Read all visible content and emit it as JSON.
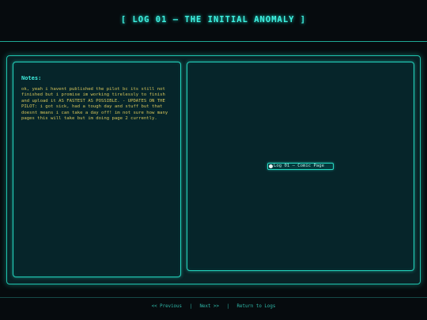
{
  "header": {
    "title": "[ LOG 01 — THE INITIAL ANOMALY ]"
  },
  "notes": {
    "heading": "Notes:",
    "body": "ok, yeah i havent published the pilot bc its still not finished but i promise im working tirelessly to finish and upload it AS FASTEST AS POSSIBLE. - UPDATES ON THE PILOT: i got sick, had a tough day and stuff but that doesnt means i can take a day off! im not sure how many pages this will take but im doing page 2 currently."
  },
  "viewer": {
    "image_alt": "Log 01 — Comic Page"
  },
  "footer": {
    "previous": "<< Previous",
    "next": "Next >>",
    "return": "Return to Logs",
    "separator": "|"
  },
  "colors": {
    "accent": "#3ff0e0",
    "border": "#23d2bb",
    "notes_text": "#d3c35a",
    "background": "#060b0e"
  }
}
